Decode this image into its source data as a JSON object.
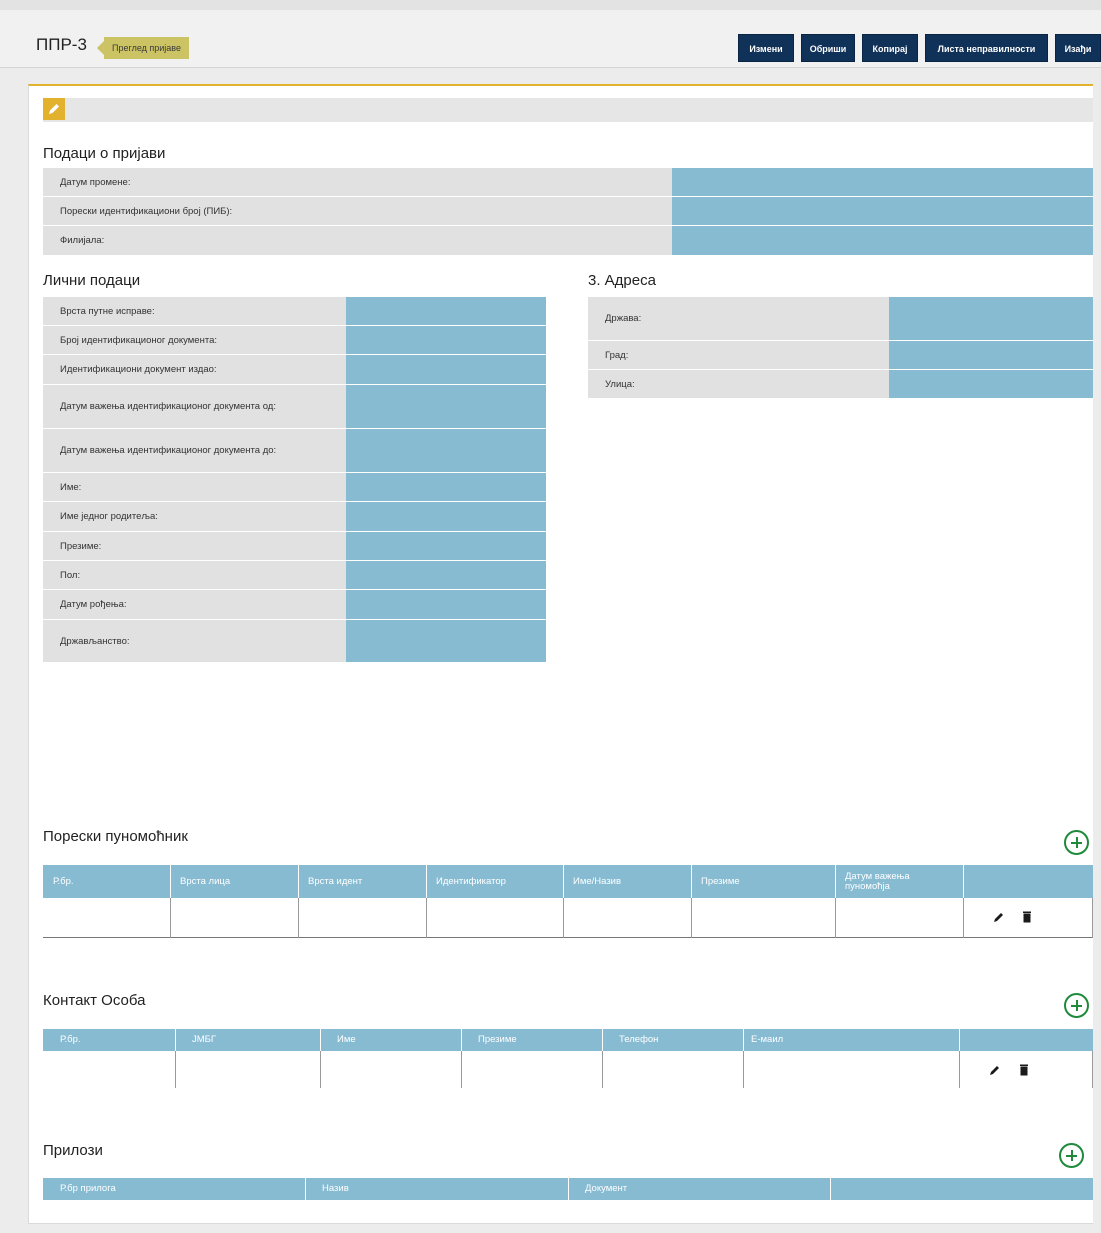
{
  "header": {
    "title": "ППР-3",
    "breadcrumb": "Преглед пријаве",
    "buttons": [
      "Измени",
      "Обриши",
      "Копирај",
      "Листа неправилности",
      "Изађи"
    ]
  },
  "info_bar": {
    "text": "· · · · · · · · · · · · · · · · · ·"
  },
  "prijava": {
    "title": "Подаци о пријави",
    "rows": [
      "Датум промене:",
      "Порески идентификациони број (ПИБ):",
      "Филијала:"
    ]
  },
  "licni": {
    "title": "Лични подаци",
    "rows": [
      "Врста путне исправе:",
      "Број идентификационог документа:",
      "Идентификациони документ издао:",
      "Датум важења идентификационог документа од:",
      "Датум важења идентификационог документа до:",
      "Име:",
      "Име једног родитеља:",
      "Презиме:",
      "Пол:",
      "Датум рођења:",
      "Држављанство:"
    ]
  },
  "adresa": {
    "title": "3. Адреса",
    "rows": [
      "Држава:",
      "Град:",
      "Улица:"
    ]
  },
  "punomocnik": {
    "title": "Порески пуномоћник",
    "columns": [
      "Р.бр.",
      "Врста лица",
      "Врста идент",
      "Идентификатор",
      "Име/Назив",
      "Презиме",
      "Датум важења пуномоћја",
      ""
    ]
  },
  "kontakt": {
    "title": "Контакт Особа",
    "columns": [
      "Р.бр.",
      "ЈМБГ",
      "Име",
      "Презиме",
      "Телефон",
      "Е-маил",
      ""
    ]
  },
  "prilozi": {
    "title": "Прилози",
    "columns": [
      "Р.бр прилога",
      "Назив",
      "Документ",
      ""
    ]
  },
  "colors": {
    "accent": "#e2b12e",
    "navy": "#103158",
    "value_blue": "#87bbd2",
    "label_gray": "#e1e1e1",
    "add_green": "#1e8a3a"
  },
  "icons": [
    "pencil-icon",
    "edit-icon",
    "trash-icon",
    "plus-circle-icon"
  ]
}
